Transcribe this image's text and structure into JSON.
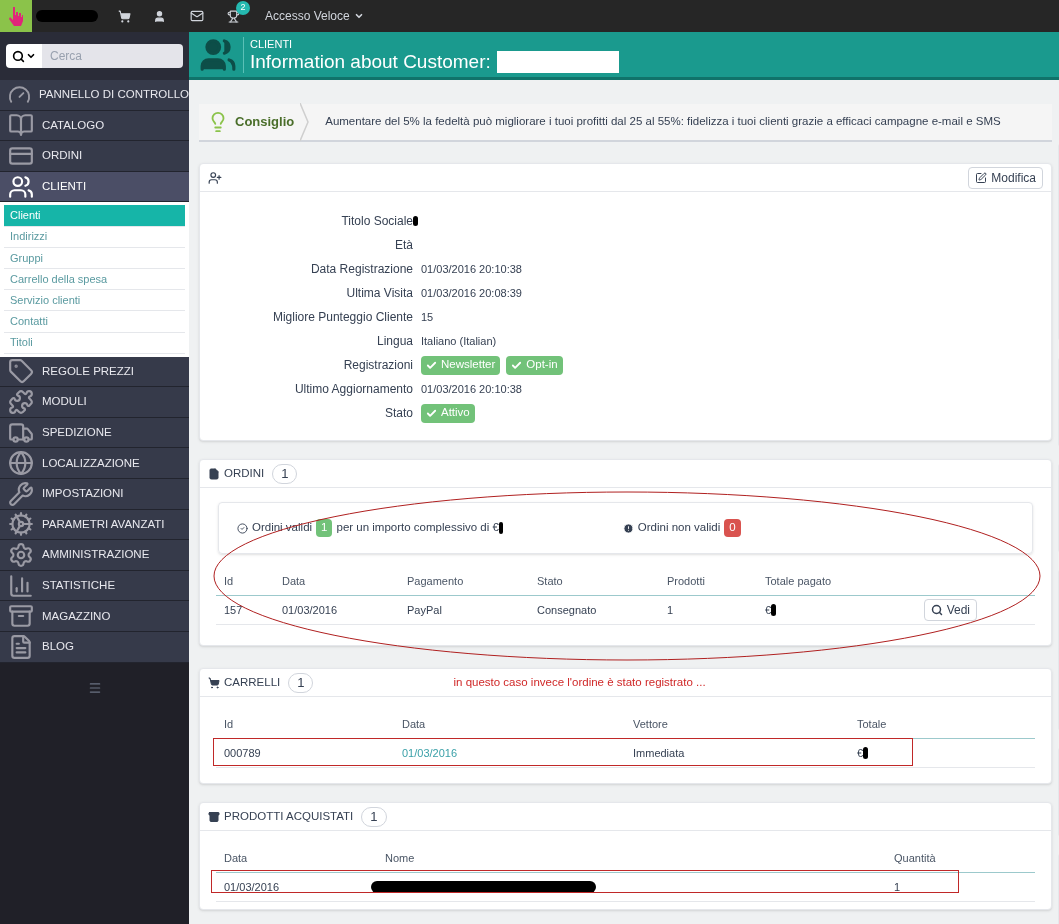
{
  "topbar": {
    "notification_count": "2",
    "quick_access": "Accesso Veloce"
  },
  "search": {
    "placeholder": "Cerca"
  },
  "sidebar": {
    "items": [
      {
        "label": "PANNELLO DI CONTROLLO",
        "selected": false
      },
      {
        "label": "CATALOGO",
        "selected": false
      },
      {
        "label": "ORDINI",
        "selected": false
      },
      {
        "label": "CLIENTI",
        "selected": true,
        "children": [
          {
            "label": "Clienti",
            "selected": true
          },
          {
            "label": "Indirizzi",
            "selected": false
          },
          {
            "label": "Gruppi",
            "selected": false
          },
          {
            "label": "Carrello della spesa",
            "selected": false
          },
          {
            "label": "Servizio clienti",
            "selected": false
          },
          {
            "label": "Contatti",
            "selected": false
          },
          {
            "label": "Titoli",
            "selected": false
          }
        ]
      },
      {
        "label": "REGOLE PREZZI",
        "selected": false
      },
      {
        "label": "MODULI",
        "selected": false
      },
      {
        "label": "SPEDIZIONE",
        "selected": false
      },
      {
        "label": "LOCALIZZAZIONE",
        "selected": false
      },
      {
        "label": "IMPOSTAZIONI",
        "selected": false
      },
      {
        "label": "PARAMETRI AVANZATI",
        "selected": false
      },
      {
        "label": "AMMINISTRAZIONE",
        "selected": false
      },
      {
        "label": "STATISTICHE",
        "selected": false
      },
      {
        "label": "MAGAZZINO",
        "selected": false
      },
      {
        "label": "BLOG",
        "selected": false
      }
    ]
  },
  "header": {
    "section": "CLIENTI",
    "title": "Information about Customer:"
  },
  "tip": {
    "label": "Consiglio",
    "text": "Aumentare del 5% la fedeltà può migliorare i tuoi profitti dal 25 al 55%: fidelizza i tuoi clienti grazie a efficaci campagne e-mail e SMS"
  },
  "customer": {
    "edit_button": "Modifica",
    "fields": [
      {
        "kind": "text",
        "label": "Titolo Sociale"
      },
      {
        "kind": "text",
        "label": "Età"
      },
      {
        "kind": "text",
        "label": "Data Registrazione",
        "value": "01/03/2016 20:10:38"
      },
      {
        "kind": "text",
        "label": "Ultima Visita",
        "value": "01/03/2016 20:08:39"
      },
      {
        "kind": "text",
        "label": "Migliore Punteggio Cliente",
        "value": "15"
      },
      {
        "kind": "text",
        "label": "Lingua",
        "value": "Italiano (Italian)"
      },
      {
        "kind": "badges",
        "label": "Registrazioni",
        "badges": [
          "Newsletter",
          "Opt-in"
        ]
      },
      {
        "kind": "text",
        "label": "Ultimo Aggiornamento",
        "value": "01/03/2016 20:10:38"
      },
      {
        "kind": "badges",
        "label": "Stato",
        "badges": [
          "Attivo"
        ]
      }
    ]
  },
  "orders": {
    "title": "ORDINI",
    "count": "1",
    "valid_label": "Ordini validi",
    "valid_count": "1",
    "valid_text": "per un importo complessivo di €",
    "invalid_label": "Ordini non validi",
    "invalid_count": "0",
    "columns": [
      "Id",
      "Data",
      "Pagamento",
      "Stato",
      "Prodotti",
      "Totale pagato"
    ],
    "rows": [
      {
        "cells": [
          "157",
          "01/03/2016",
          "PayPal",
          "Consegnato",
          "1",
          "€"
        ],
        "action": "Vedi"
      }
    ]
  },
  "carts": {
    "title": "CARRELLI",
    "count": "1",
    "note": "in questo caso invece l'ordine è stato registrato ...",
    "columns": [
      "Id",
      "Data",
      "Vettore",
      "Totale"
    ],
    "rows": [
      {
        "cells": [
          "000789",
          "01/03/2016",
          "Immediata",
          "€"
        ]
      }
    ]
  },
  "products": {
    "title": "PRODOTTI ACQUISTATI",
    "count": "1",
    "columns": [
      "Data",
      "Nome",
      "Quantità"
    ],
    "rows": [
      {
        "cells": [
          "01/03/2016",
          "",
          "1"
        ]
      }
    ]
  }
}
